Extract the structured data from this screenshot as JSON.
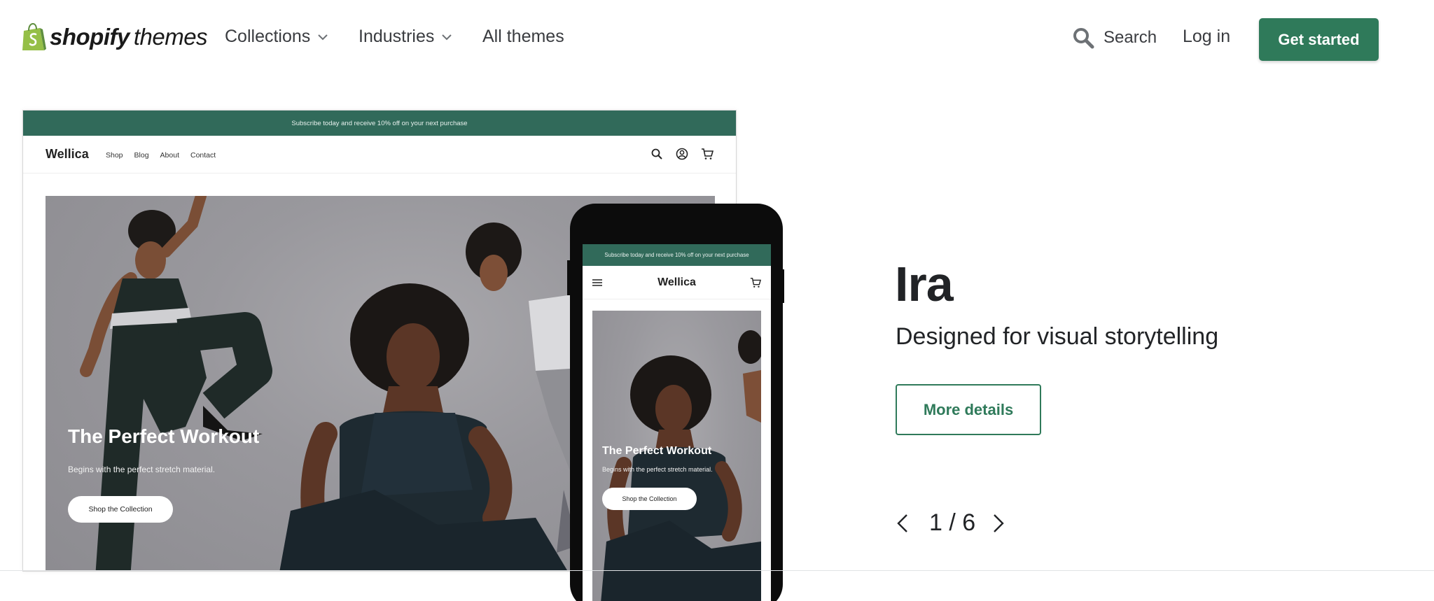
{
  "nav": {
    "logo": {
      "word1": "shopify",
      "word2": "themes"
    },
    "links": [
      {
        "label": "Collections",
        "has_dropdown": true
      },
      {
        "label": "Industries",
        "has_dropdown": true
      },
      {
        "label": "All themes",
        "has_dropdown": false
      }
    ],
    "search_label": "Search",
    "login_label": "Log in",
    "cta_label": "Get started",
    "cta_color": "#2f7a5a"
  },
  "preview": {
    "desktop": {
      "banner": "Subscribe today and receive 10% off on your next purchase",
      "brand": "Wellica",
      "menu": [
        "Shop",
        "Blog",
        "About",
        "Contact"
      ],
      "icons": [
        "search-icon",
        "account-icon",
        "cart-icon"
      ],
      "hero_title": "The Perfect Workout",
      "hero_subtitle": "Begins with the perfect stretch material.",
      "hero_button": "Shop the Collection",
      "banner_color": "#316a5a"
    },
    "mobile": {
      "banner": "Subscribe today and receive 10% off on your next purchase",
      "brand": "Wellica",
      "hero_title": "The Perfect Workout",
      "hero_subtitle": "Begins with the perfect stretch material.",
      "hero_button": "Shop the Collection"
    }
  },
  "theme": {
    "name": "Ira",
    "tagline": "Designed for visual storytelling",
    "details_button": "More details",
    "pager": "1 / 6"
  }
}
